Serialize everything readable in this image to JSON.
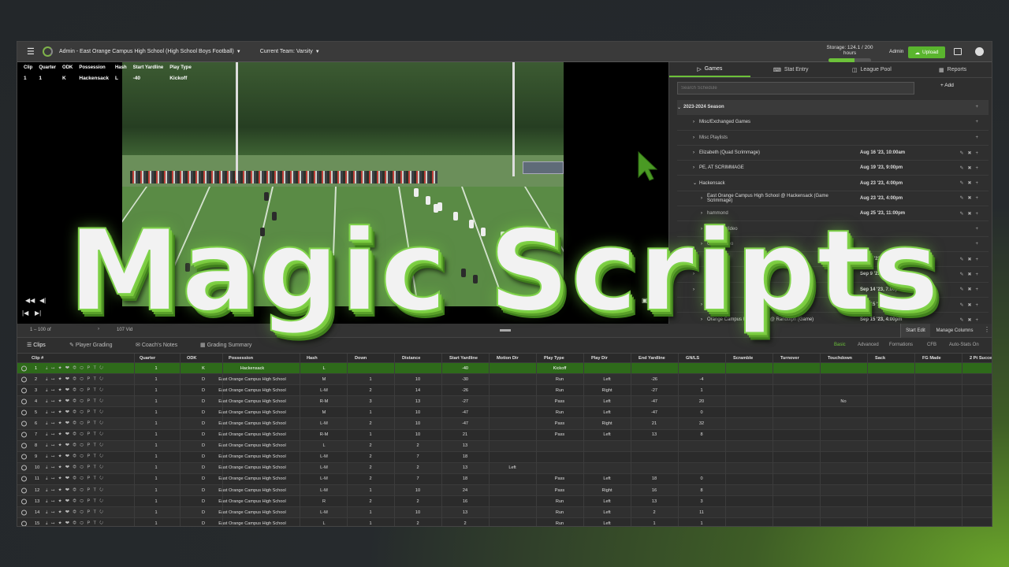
{
  "header": {
    "org_title": "Admin - East Orange Campus High School (High School Boys Football)",
    "current_team": "Current Team: Varsity",
    "storage_label": "Storage: 124.1 / 200 hours",
    "storage_fraction": 0.62,
    "admin_label": "Admin",
    "upload_label": "Upload"
  },
  "clip_info": {
    "headers": [
      "Clip",
      "Quarter",
      "ODK",
      "Possession",
      "Hash",
      "Start Yardline",
      "Play Type"
    ],
    "values": [
      "1",
      "1",
      "K",
      "Hackensack",
      "L",
      "-40",
      "Kickoff"
    ]
  },
  "right_panel": {
    "tabs": [
      "Games",
      "Stat Entry",
      "League Pool",
      "Reports"
    ],
    "search_placeholder": "Search Schedule",
    "add_label": "Add",
    "rows": [
      {
        "name": "2023-2024 Season",
        "date": "",
        "kind": "season",
        "indent": 8
      },
      {
        "name": "Misc/Exchanged Games",
        "date": "",
        "kind": "sub",
        "indent": 28
      },
      {
        "name": "Misc Playlists",
        "date": "",
        "kind": "video",
        "indent": 28
      },
      {
        "name": "Elizabeth (Quad Scrimmage)",
        "date": "Aug 16 '23, 10:00am",
        "kind": "sub",
        "indent": 28
      },
      {
        "name": "PE, AT SCRIMMAGE",
        "date": "Aug 19 '23, 9:00pm",
        "kind": "sub",
        "indent": 28
      },
      {
        "name": "Hackensack",
        "date": "Aug 23 '23, 4:00pm",
        "kind": "sub",
        "indent": 28
      },
      {
        "name": "East Orange Campus High School @ Hackensack (Game Scrimmage)",
        "date": "Aug 23 '23, 4:00pm",
        "kind": "sub",
        "indent": 38
      },
      {
        "name": "hammond",
        "date": "Aug 25 '23, 11:00pm",
        "kind": "video",
        "indent": 38
      },
      {
        "name": "Practice Video",
        "date": "",
        "kind": "video",
        "indent": 38
      },
      {
        "name": "Game Video",
        "date": "",
        "kind": "video",
        "indent": 38
      },
      {
        "name": "",
        "date": "Sep 2 '23, 1:00pm",
        "kind": "sub",
        "indent": 28
      },
      {
        "name": "",
        "date": "Sep 9 '23, 1:00pm",
        "kind": "sub",
        "indent": 28
      },
      {
        "name": "",
        "date": "Sep 14 '23, 7:00pm",
        "kind": "sub",
        "indent": 28
      },
      {
        "name": "School vs",
        "date": "Sep 15 '23, 12:00am",
        "kind": "sub",
        "indent": 38
      },
      {
        "name": "Orange Campus High School @ Randolph (Game)",
        "date": "Sep 15 '23, 4:00pm",
        "kind": "sub",
        "indent": 38
      }
    ]
  },
  "toolbar": {
    "range_label": "1 – 100 of",
    "video_label": "107 Vid",
    "start_edit": "Start Edit",
    "manage_columns": "Manage Columns"
  },
  "bottom_tabs": [
    "Clips",
    "Player Grading",
    "Coach's Notes",
    "Grading Summary"
  ],
  "view_options": [
    "Basic",
    "Advanced",
    "Formations",
    "CFB",
    "Auto-Stats On"
  ],
  "table": {
    "columns": [
      "Clip #",
      "Quarter",
      "ODK",
      "Possession",
      "Hash",
      "Down",
      "Distance",
      "Start Yardline",
      "Motion Dir",
      "Play Type",
      "Play Dir",
      "End Yardline",
      "GN/LS",
      "Scramble",
      "Turnover",
      "Touchdown",
      "Sack",
      "FG Made",
      "2 Pt Successful"
    ],
    "rows": [
      [
        "1",
        "1",
        "K",
        "Hackensack",
        "L",
        "",
        "",
        "-40",
        "",
        "Kickoff",
        "",
        "",
        "",
        "",
        "",
        "",
        "",
        "",
        ""
      ],
      [
        "2",
        "1",
        "D",
        "East Orange Campus High School",
        "M",
        "1",
        "10",
        "-30",
        "",
        "Run",
        "Left",
        "-26",
        "-4",
        "",
        "",
        "",
        "",
        "",
        ""
      ],
      [
        "3",
        "1",
        "D",
        "East Orange Campus High School",
        "L-M",
        "2",
        "14",
        "-26",
        "",
        "Run",
        "Right",
        "-27",
        "1",
        "",
        "",
        "",
        "",
        "",
        ""
      ],
      [
        "4",
        "1",
        "D",
        "East Orange Campus High School",
        "R-M",
        "3",
        "13",
        "-27",
        "",
        "Pass",
        "Left",
        "-47",
        "20",
        "",
        "",
        "No",
        "",
        "",
        ""
      ],
      [
        "5",
        "1",
        "D",
        "East Orange Campus High School",
        "M",
        "1",
        "10",
        "-47",
        "",
        "Run",
        "Left",
        "-47",
        "0",
        "",
        "",
        "",
        "",
        "",
        ""
      ],
      [
        "6",
        "1",
        "D",
        "East Orange Campus High School",
        "L-M",
        "2",
        "10",
        "-47",
        "",
        "Pass",
        "Right",
        "21",
        "32",
        "",
        "",
        "",
        "",
        "",
        ""
      ],
      [
        "7",
        "1",
        "D",
        "East Orange Campus High School",
        "R-M",
        "1",
        "10",
        "21",
        "",
        "Pass",
        "Left",
        "13",
        "8",
        "",
        "",
        "",
        "",
        "",
        ""
      ],
      [
        "8",
        "1",
        "D",
        "East Orange Campus High School",
        "L",
        "2",
        "2",
        "13",
        "",
        "",
        "",
        "",
        "",
        "",
        "",
        "",
        "",
        "",
        ""
      ],
      [
        "9",
        "1",
        "D",
        "East Orange Campus High School",
        "L-M",
        "2",
        "7",
        "18",
        "",
        "",
        "",
        "",
        "",
        "",
        "",
        "",
        "",
        "",
        ""
      ],
      [
        "10",
        "1",
        "D",
        "East Orange Campus High School",
        "L-M",
        "2",
        "2",
        "13",
        "Left",
        "",
        "",
        "",
        "",
        "",
        "",
        "",
        "",
        "",
        ""
      ],
      [
        "11",
        "1",
        "D",
        "East Orange Campus High School",
        "L-M",
        "2",
        "7",
        "18",
        "",
        "Pass",
        "Left",
        "18",
        "0",
        "",
        "",
        "",
        "",
        "",
        ""
      ],
      [
        "12",
        "1",
        "D",
        "East Orange Campus High School",
        "L-M",
        "1",
        "10",
        "24",
        "",
        "Pass",
        "Right",
        "16",
        "8",
        "",
        "",
        "",
        "",
        "",
        ""
      ],
      [
        "13",
        "1",
        "D",
        "East Orange Campus High School",
        "R",
        "2",
        "2",
        "16",
        "",
        "Run",
        "Left",
        "13",
        "3",
        "",
        "",
        "",
        "",
        "",
        ""
      ],
      [
        "14",
        "1",
        "D",
        "East Orange Campus High School",
        "L-M",
        "1",
        "10",
        "13",
        "",
        "Run",
        "Left",
        "2",
        "11",
        "",
        "",
        "",
        "",
        "",
        ""
      ],
      [
        "15",
        "1",
        "D",
        "East Orange Campus High School",
        "L",
        "1",
        "2",
        "2",
        "",
        "Run",
        "Left",
        "1",
        "1",
        "",
        "",
        "",
        "",
        "",
        ""
      ]
    ]
  },
  "overlay": {
    "title": "Magic Scripts"
  },
  "colors": {
    "accent": "#6cc13a",
    "selected_row": "#2e6a1a"
  }
}
